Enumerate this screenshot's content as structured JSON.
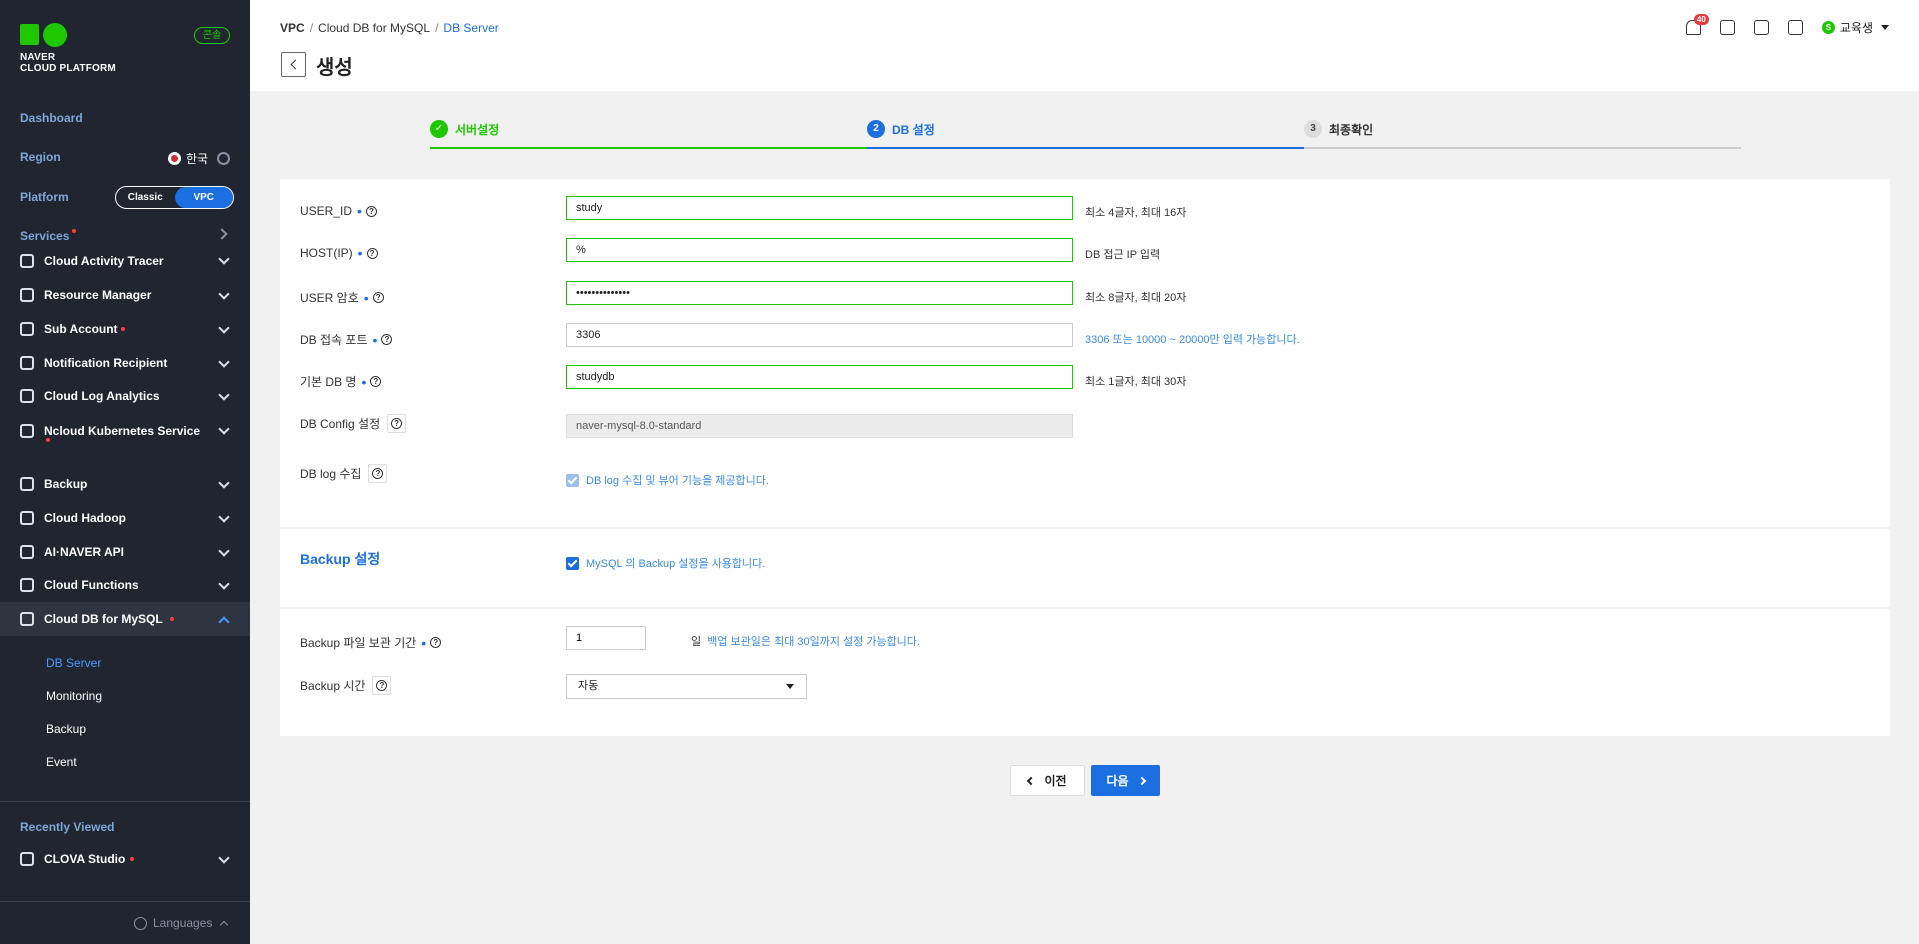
{
  "brand": {
    "line1": "NAVER",
    "line2": "CLOUD PLATFORM",
    "badge": "콘솔",
    "color": "#1ec800"
  },
  "sidebar": {
    "dashboard": "Dashboard",
    "region_label": "Region",
    "region_value": "한국",
    "platform_label": "Platform",
    "platform_options": [
      "Classic",
      "VPC"
    ],
    "platform_selected": "VPC",
    "services_label": "Services",
    "menu": [
      {
        "label": "Cloud Activity Tracer",
        "icon": "activity-icon"
      },
      {
        "label": "Resource Manager",
        "icon": "resource-icon"
      },
      {
        "label": "Sub Account",
        "icon": "users-icon",
        "dot": true
      },
      {
        "label": "Notification Recipient",
        "icon": "contact-icon"
      },
      {
        "label": "Cloud Log Analytics",
        "icon": "log-icon"
      },
      {
        "label": "Ncloud Kubernetes Service",
        "icon": "kubernetes-icon",
        "dot": true
      },
      {
        "label": "Backup",
        "icon": "backup-icon"
      },
      {
        "label": "Cloud Hadoop",
        "icon": "hadoop-icon"
      },
      {
        "label": "AI·NAVER API",
        "icon": "api-icon"
      },
      {
        "label": "Cloud Functions",
        "icon": "functions-icon"
      },
      {
        "label": "Cloud DB for MySQL",
        "icon": "database-icon",
        "dot": true,
        "expanded": true
      }
    ],
    "submenu": [
      "DB Server",
      "Monitoring",
      "Backup",
      "Event"
    ],
    "submenu_current": "DB Server",
    "recently_viewed_label": "Recently Viewed",
    "recent": [
      {
        "label": "CLOVA Studio",
        "icon": "clova-icon",
        "dot": true
      }
    ],
    "languages": "Languages"
  },
  "header": {
    "breadcrumb": [
      "VPC",
      "Cloud DB for MySQL",
      "DB Server"
    ],
    "title": "생성",
    "notification_count": "40",
    "user_initial": "S",
    "user_name": "교육생"
  },
  "steps": [
    {
      "num": "✓",
      "label": "서버설정",
      "state": "done"
    },
    {
      "num": "2",
      "label": "DB 설정",
      "state": "current"
    },
    {
      "num": "3",
      "label": "최종확인",
      "state": "pending"
    }
  ],
  "form": {
    "user_id": {
      "label": "USER_ID",
      "value": "study",
      "hint": "최소 4글자, 최대 16자"
    },
    "host": {
      "label": "HOST(IP)",
      "value": "%",
      "hint": "DB 접근 IP 입력"
    },
    "password": {
      "label": "USER 암호",
      "value": "••••••••••••••",
      "hint": "최소 8글자, 최대 20자"
    },
    "port": {
      "label": "DB 접속 포트",
      "value": "3306",
      "hint": "3306 또는 10000 ~ 20000만 입력 가능합니다."
    },
    "db_name": {
      "label": "기본 DB 명",
      "value": "studydb",
      "hint": "최소 1글자, 최대 30자"
    },
    "config": {
      "label": "DB Config 설정",
      "value": "naver-mysql-8.0-standard"
    },
    "log": {
      "label": "DB log 수집",
      "check_text": "DB log 수집 및 뷰어 기능을 제공합니다."
    }
  },
  "backup": {
    "title": "Backup 설정",
    "check_text": "MySQL 의 Backup 설정을 사용합니다.",
    "retention_label": "Backup 파일 보관 기간",
    "retention_value": "1",
    "retention_unit": "일",
    "retention_hint": "백업 보관일은 최대 30일까지 설정 가능합니다.",
    "time_label": "Backup 시간",
    "time_value": "자동"
  },
  "buttons": {
    "prev": "이전",
    "next": "다음"
  },
  "colors": {
    "accent": "#1b6fe0",
    "success": "#1ec800",
    "sidebar_bg": "#202530"
  }
}
